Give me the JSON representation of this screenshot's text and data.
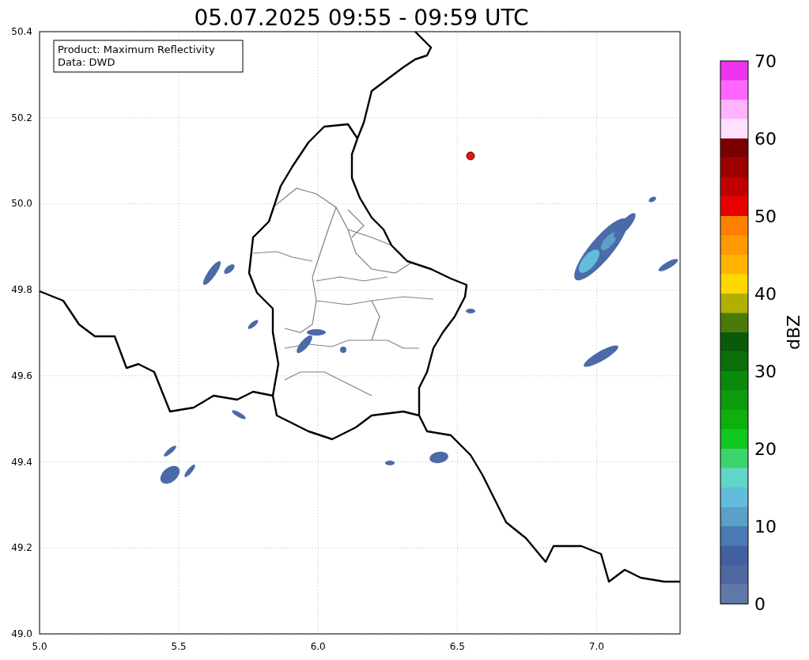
{
  "title": "05.07.2025 09:55 - 09:59 UTC",
  "annotation": {
    "lines": [
      "Product: Maximum Reflectivity",
      "Data: DWD"
    ]
  },
  "map": {
    "xticks": [
      "5.0",
      "5.5",
      "6.0",
      "6.5",
      "7.0"
    ],
    "yticks": [
      "50.4",
      "50.2",
      "50.0",
      "49.8",
      "49.6",
      "49.4",
      "49.2",
      "49.0"
    ]
  },
  "colorbar": {
    "label": "dBZ",
    "ticks": [
      "70",
      "60",
      "50",
      "40",
      "30",
      "20",
      "10",
      "0"
    ],
    "segments": [
      {
        "color": "#ee33ee"
      },
      {
        "color": "#ff66ff"
      },
      {
        "color": "#ffb3ff"
      },
      {
        "color": "#ffe0ff"
      },
      {
        "color": "#7a0000"
      },
      {
        "color": "#9e0000"
      },
      {
        "color": "#c00000"
      },
      {
        "color": "#e60000"
      },
      {
        "color": "#ff8000"
      },
      {
        "color": "#ff9900"
      },
      {
        "color": "#ffb300"
      },
      {
        "color": "#ffd700"
      },
      {
        "color": "#b0b000"
      },
      {
        "color": "#4a7a0a"
      },
      {
        "color": "#0a5a0a"
      },
      {
        "color": "#0a6e0a"
      },
      {
        "color": "#0a8a0a"
      },
      {
        "color": "#0c9c0c"
      },
      {
        "color": "#0eb00e"
      },
      {
        "color": "#10c820"
      },
      {
        "color": "#3cd46c"
      },
      {
        "color": "#60d6c8"
      },
      {
        "color": "#62bcdc"
      },
      {
        "color": "#5aa0c8"
      },
      {
        "color": "#4a7ab4"
      },
      {
        "color": "#4260a0"
      },
      {
        "color": "#5068a0"
      },
      {
        "color": "#6078a8"
      }
    ]
  }
}
